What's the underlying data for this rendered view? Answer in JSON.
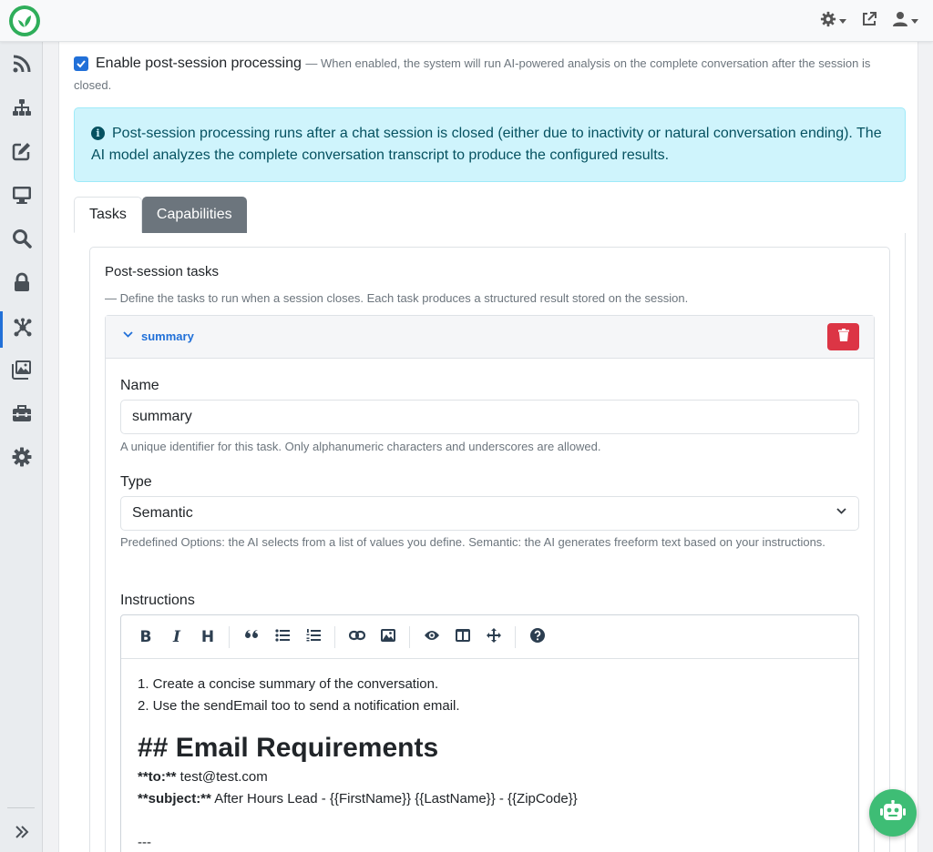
{
  "top_bar": {
    "logo_name": "app-logo",
    "icons": [
      "gear-icon",
      "external-link-icon",
      "user-icon"
    ]
  },
  "sidebar": {
    "items": [
      "feed-icon",
      "sitemap-icon",
      "edit-icon",
      "monitor-icon",
      "search-icon",
      "lock-icon",
      "network-icon",
      "images-icon",
      "toolbox-icon",
      "settings-icon"
    ],
    "active_index": 6,
    "expand_icon": "double-chevron-right-icon"
  },
  "settings": {
    "enable_label": "Enable post-session processing",
    "enable_desc": "— When enabled, the system will run AI-powered analysis on the complete conversation after the session is closed.",
    "enabled": true
  },
  "alert": {
    "text": "Post-session processing runs after a chat session is closed (either due to inactivity or natural conversation ending). The AI model analyzes the complete conversation transcript to produce the configured results."
  },
  "tabs": [
    {
      "label": "Tasks",
      "active": true
    },
    {
      "label": "Capabilities",
      "active": false
    }
  ],
  "tasks": {
    "title": "Post-session tasks",
    "subtitle": "— Define the tasks to run when a session closes. Each task produces a structured result stored on the session.",
    "task": {
      "header": "summary",
      "name_label": "Name",
      "name_value": "summary",
      "name_help": "A unique identifier for this task. Only alphanumeric characters and underscores are allowed.",
      "type_label": "Type",
      "type_value": "Semantic",
      "type_help": "Predefined Options: the AI selects from a list of values you define. Semantic: the AI generates freeform text based on your instructions.",
      "instructions_label": "Instructions",
      "instructions": {
        "line1": "1. Create a concise summary of the conversation.",
        "line2": "2. Use the sendEmail too to send a notification email.",
        "heading": "## Email Requirements",
        "to_key": "**to:**",
        "to_value": " test@test.com",
        "subject_key": "**subject:**",
        "subject_value": " After Hours Lead - {{FirstName}} {{LastName}} - {{ZipCode}}",
        "separator": "---"
      }
    }
  },
  "colors": {
    "primary": "#2170d8",
    "danger": "#dc3545",
    "info_bg": "#cff4fc",
    "info_text": "#055160",
    "brand_green": "#3ebd75"
  }
}
